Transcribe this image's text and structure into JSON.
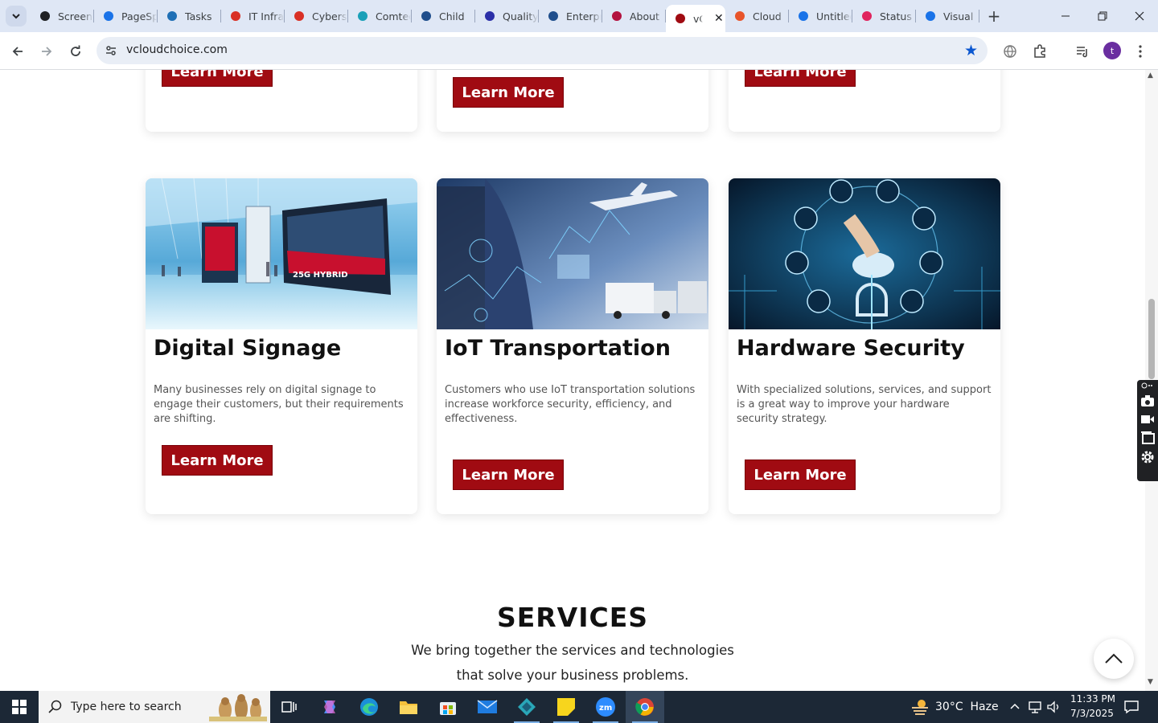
{
  "browser": {
    "tabs": [
      {
        "title": "Screencastify",
        "color": "#202124",
        "active": false
      },
      {
        "title": "PageSpeed",
        "color": "#1a73e8",
        "active": false
      },
      {
        "title": "Tasks",
        "color": "#1f6fb5",
        "active": false
      },
      {
        "title": "IT Infrastructure",
        "color": "#d93025",
        "active": false
      },
      {
        "title": "Cybersecurity",
        "color": "#d93025",
        "active": false
      },
      {
        "title": "Comtech",
        "color": "#1aa0b8",
        "active": false
      },
      {
        "title": "Child",
        "color": "#1f4e8c",
        "active": false
      },
      {
        "title": "Quality",
        "color": "#2b2fa8",
        "active": false
      },
      {
        "title": "Enterprise",
        "color": "#1f4e8c",
        "active": false
      },
      {
        "title": "About",
        "color": "#b3123f",
        "active": false
      },
      {
        "title": "vCloudChoice",
        "color": "#a00b12",
        "active": true
      },
      {
        "title": "Cloud",
        "color": "#e8542a",
        "active": false
      },
      {
        "title": "Untitled",
        "color": "#1a73e8",
        "active": false
      },
      {
        "title": "Status",
        "color": "#e0245e",
        "active": false
      },
      {
        "title": "Visual",
        "color": "#1a73e8",
        "active": false
      }
    ],
    "url": "vcloudchoice.com"
  },
  "page": {
    "top_button_label": "Learn More",
    "cards": [
      {
        "title": "Digital Signage",
        "text": "Many businesses rely on digital signage to engage their customers, but their requirements are shifting.",
        "button": "Learn More"
      },
      {
        "title": "IoT Transportation",
        "text": "Customers who use IoT transportation solutions increase workforce security, efficiency, and effectiveness.",
        "button": "Learn More"
      },
      {
        "title": "Hardware Security",
        "text": "With specialized solutions, services, and support is a great way to improve your hardware security strategy.",
        "button": "Learn More"
      }
    ],
    "services": {
      "title": "SERVICES",
      "line1": "We bring together the services and technologies",
      "line2": "that solve your business problems."
    },
    "signage_text": "25G HYBRID"
  },
  "taskbar": {
    "search_placeholder": "Type here to search",
    "weather": "30°C  Haze",
    "time": "11:33 PM",
    "date": "7/3/2025"
  },
  "colors": {
    "brand": "#a00b12",
    "tabstrip": "#dfe7f5",
    "taskbar": "#1c2836"
  }
}
